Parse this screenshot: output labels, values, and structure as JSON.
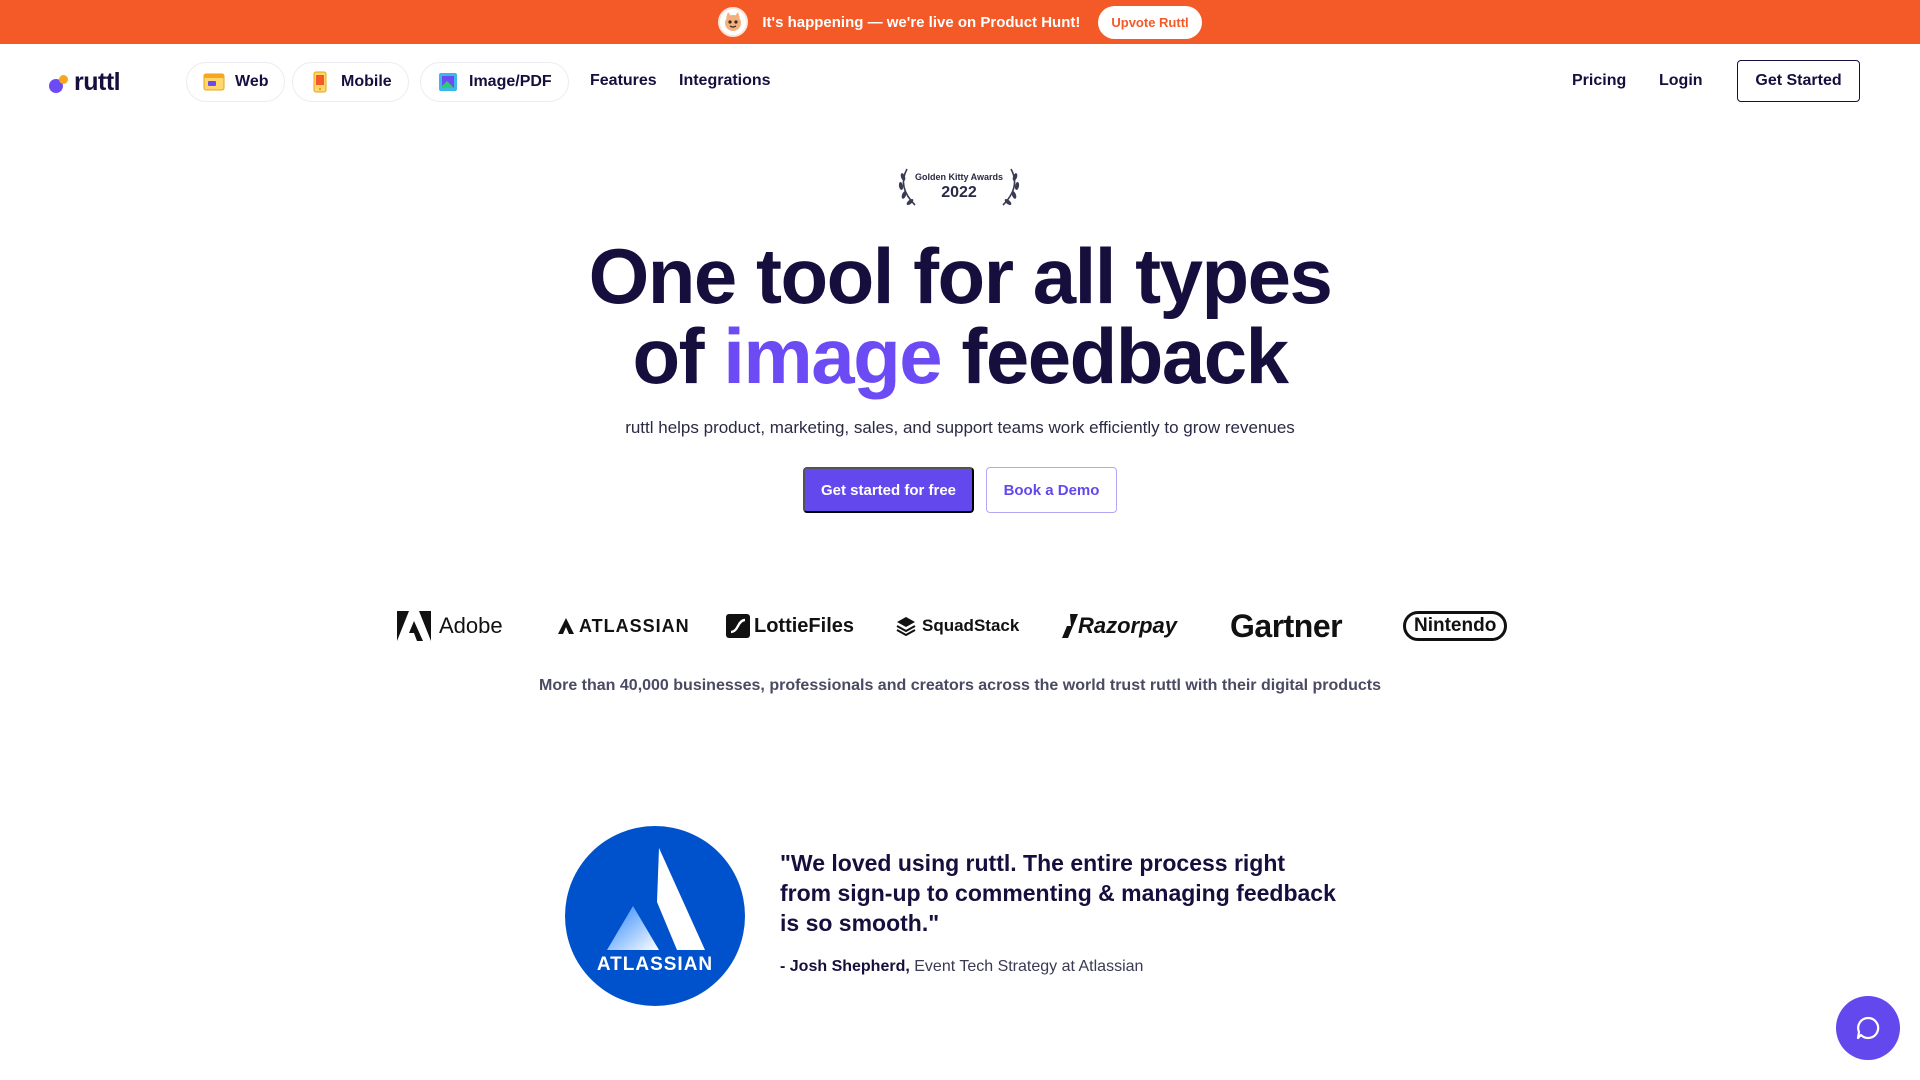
{
  "announcement": {
    "message": "It's happening — we're live on Product Hunt!",
    "button_label": "Upvote Ruttl",
    "bg_color": "#f45a27"
  },
  "nav": {
    "logo_text": "ruttl",
    "products": [
      {
        "label": "Web",
        "icon": "web-window-icon"
      },
      {
        "label": "Mobile",
        "icon": "mobile-phone-icon"
      },
      {
        "label": "Image/PDF",
        "icon": "image-pdf-icon"
      }
    ],
    "links": [
      "Features",
      "Integrations"
    ],
    "right_links": [
      "Pricing",
      "Login"
    ],
    "cta_label": "Get Started"
  },
  "award": {
    "name": "Golden Kitty Awards",
    "year": "2022"
  },
  "hero": {
    "title_line1": "One tool for all types",
    "title_prefix": "of",
    "title_accent": "image",
    "title_suffix": "feedback",
    "accent_color": "#6c4bf5",
    "subtitle": "ruttl helps product, marketing, sales, and support teams work efficiently to grow revenues",
    "primary_cta": "Get started for free",
    "secondary_cta": "Book a Demo"
  },
  "clients": {
    "logos": [
      "Adobe",
      "ATLASSIAN",
      "LottieFiles",
      "SquadStack",
      "Razorpay",
      "Gartner",
      "Nintendo"
    ],
    "trust_text": "More than 40,000 businesses, professionals and creators across the world trust ruttl with their digital products"
  },
  "testimonial": {
    "company_badge": "ATLASSIAN",
    "quote": "\"We loved using ruttl. The entire process right from sign-up to commenting & managing feedback is so smooth.\"",
    "author_name": "- Josh Shepherd,",
    "author_role": "Event Tech Strategy at Atlassian"
  },
  "chat_widget": {
    "icon": "chat-bubble-icon"
  }
}
